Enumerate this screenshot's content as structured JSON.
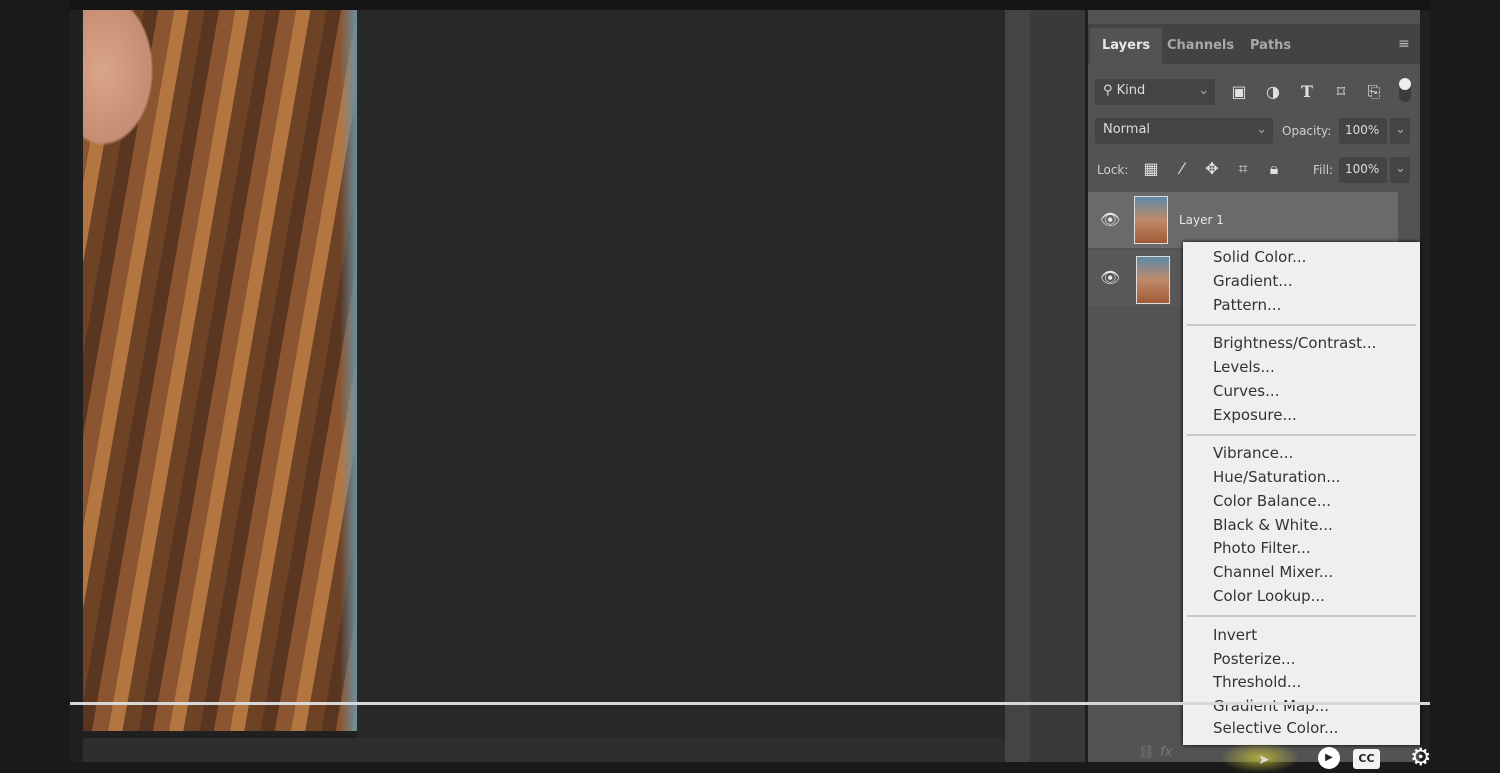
{
  "panel": {
    "tabs": [
      "Layers",
      "Channels",
      "Paths"
    ],
    "filter_kind": "Kind",
    "blend_mode": "Normal",
    "opacity_label": "Opacity:",
    "opacity_value": "100%",
    "lock_label": "Lock:",
    "fill_label": "Fill:",
    "fill_value": "100%",
    "layers": [
      {
        "name": "Layer 1",
        "visible": true
      },
      {
        "name": "",
        "visible": true
      }
    ]
  },
  "adjustment_menu": {
    "groups": [
      [
        "Solid Color...",
        "Gradient...",
        "Pattern..."
      ],
      [
        "Brightness/Contrast...",
        "Levels...",
        "Curves...",
        "Exposure..."
      ],
      [
        "Vibrance...",
        "Hue/Saturation...",
        "Color Balance...",
        "Black & White...",
        "Photo Filter...",
        "Channel Mixer...",
        "Color Lookup..."
      ],
      [
        "Invert",
        "Posterize...",
        "Threshold...",
        "Gradient Map...",
        "Selective Color..."
      ]
    ]
  },
  "player": {
    "cc_label": "CC"
  }
}
